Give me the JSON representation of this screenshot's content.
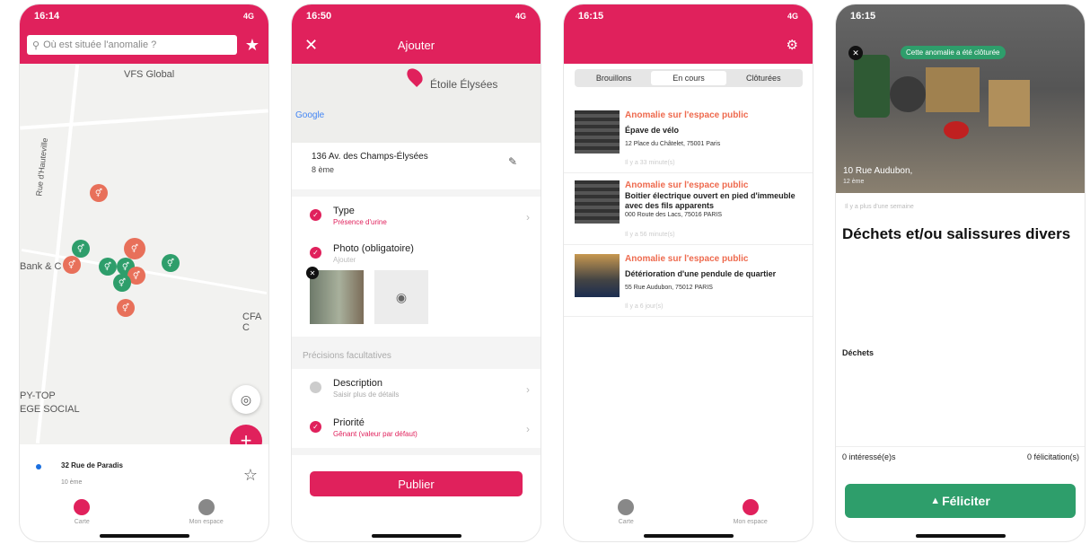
{
  "colors": {
    "primary": "#e0215c",
    "green": "#2e9e6b",
    "orange": "#e8705a"
  },
  "screen1": {
    "status_time": "16:14",
    "status_network": "4G",
    "search_placeholder": "Où est située l'anomalie ?",
    "map_labels": [
      "VFS Global",
      "Rue d'Hauteville",
      "Bank & C",
      "CFA C",
      "PY-TOP",
      "EGE SOCIAL"
    ],
    "address_line1": "32 Rue de Paradis",
    "address_line2": "10 ème",
    "tabs": [
      "Carte",
      "Mon espace"
    ]
  },
  "screen2": {
    "status_time": "16:50",
    "status_network": "4G",
    "title": "Ajouter",
    "map_place": "Étoile Élysées",
    "map_brand": "Google",
    "address_line1": "136 Av. des Champs-Élysées",
    "address_line2": "8 ème",
    "type_label": "Type",
    "type_value": "Présence d'urine",
    "photo_label": "Photo (obligatoire)",
    "photo_sub": "Ajouter",
    "section_optional": "Précisions facultatives",
    "desc_label": "Description",
    "desc_sub": "Saisir plus de détails",
    "priority_label": "Priorité",
    "priority_value": "Gênant (valeur par défaut)",
    "publish": "Publier"
  },
  "screen3": {
    "status_time": "16:15",
    "status_network": "4G",
    "segments": [
      "Brouillons",
      "En cours",
      "Clôturées"
    ],
    "items": [
      {
        "category": "Anomalie sur l'espace public",
        "title": "Épave de vélo",
        "address": "12  Place du Châtelet, 75001 Paris",
        "time": "Il y a 33 minute(s)"
      },
      {
        "category": "Anomalie sur l'espace public",
        "title": "Boitier électrique ouvert en pied d'immeuble avec des fils apparents",
        "address": "000  Route des Lacs, 75016 PARIS",
        "time": "Il y a 56 minute(s)"
      },
      {
        "category": "Anomalie sur l'espace public",
        "title": "Détérioration d'une pendule de quartier",
        "address": "55 Rue Audubon, 75012 PARIS",
        "time": "Il y a 6 jour(s)"
      }
    ],
    "tabs": [
      "Carte",
      "Mon espace"
    ]
  },
  "screen4": {
    "status_time": "16:15",
    "closed_badge": "Cette anomalie a été clôturée",
    "photo_address": "10 Rue Audubon,",
    "photo_district": "12 ème",
    "time": "Il y a plus d'une semaine",
    "title": "Déchets et/ou salissures divers",
    "category": "Déchets",
    "interested": "0 intéressé(e)s",
    "congrats": "0 félicitation(s)",
    "button": "Féliciter"
  }
}
